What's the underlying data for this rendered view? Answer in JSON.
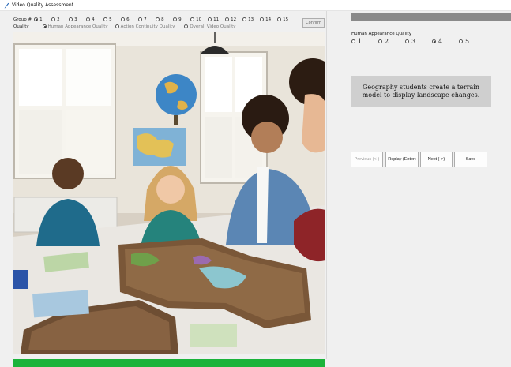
{
  "window": {
    "title": "Video Quality Assessment"
  },
  "group": {
    "label": "Group #",
    "options": [
      "1",
      "2",
      "3",
      "4",
      "5",
      "6",
      "7",
      "8",
      "9",
      "10",
      "11",
      "12",
      "13",
      "14",
      "15"
    ],
    "selected": "1"
  },
  "quality": {
    "label": "Quality",
    "options": [
      "Human Appearance Quality",
      "Action Continuity Quality",
      "Overall Video Quality"
    ],
    "selected": "Human Appearance Quality"
  },
  "confirm_label": "Confirm",
  "video": {
    "progress": 1.0,
    "progress_color": "#1bb33a"
  },
  "rating": {
    "label": "Human Appearance Quality",
    "options": [
      "1",
      "2",
      "3",
      "4",
      "5"
    ],
    "selected": "4"
  },
  "caption": "Geography students create a terrain model to display landscape changes.",
  "buttons": {
    "previous": "Previous (<-)",
    "replay": "Replay (Enter)",
    "next": "Next (->)",
    "save": "Save"
  }
}
